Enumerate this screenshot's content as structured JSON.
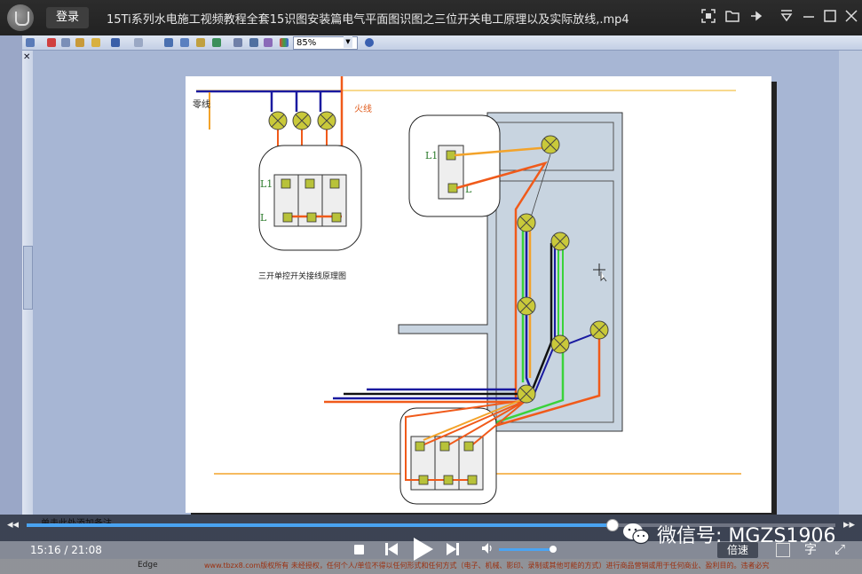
{
  "window": {
    "login_label": "登录",
    "title": "15Ti系列水电施工视频教程全套15识图安装篇电气平面图识图之三位开关电工原理以及实际放线,.mp4"
  },
  "visio": {
    "zoom": "85%",
    "note_text": "单击此处添加备注",
    "page_tab": "Edge",
    "disclaimer": "www.tbzx8.com版权所有 未经授权，任何个人/单位不得以任何形式和任何方式（电子、机械、影印、录制或其他可能的方式）进行商品营销或用于任何商业、盈利目的。违者必究"
  },
  "diagram": {
    "label_neutral": "零线",
    "label_live": "火线",
    "label_l1_left": "L1",
    "label_l_left": "L",
    "label_l1_right": "L1",
    "label_l_right": "L",
    "caption": "三开单控开关接线原理图",
    "colors": {
      "neutral": "#1a1aa0",
      "live": "#f05a1a",
      "orange": "#f3a32a",
      "green": "#3ad23a",
      "black": "#111111",
      "room_fill": "#c8d4e0",
      "lamp": "#c9c93a"
    }
  },
  "player": {
    "time": "15:16 / 21:08",
    "progress": 0.723,
    "volume": 0.95,
    "watermark": "微信号: MGZS1906",
    "speed_label": "倍速",
    "subtitle_label": "字"
  }
}
